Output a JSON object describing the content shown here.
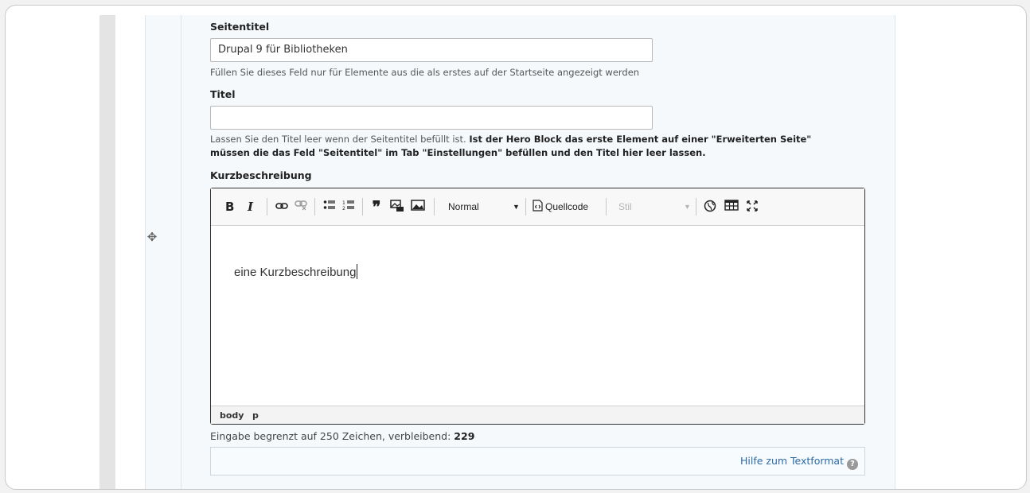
{
  "seitentitel": {
    "label": "Seitentitel",
    "value": "Drupal 9 für Bibliotheken",
    "help": "Füllen Sie dieses Feld nur für Elemente aus die als erstes auf der Startseite angezeigt werden"
  },
  "titel": {
    "label": "Titel",
    "value": "",
    "help_plain": "Lassen Sie den Titel leer wenn der Seitentitel befüllt ist.",
    "help_bold_1": "Ist der Hero Block das erste Element auf einer \"Erweiterten Seite\"",
    "help_bold_2": "müssen die das Feld \"Seitentitel\" im Tab \"Einstellungen\" befüllen und den Titel hier leer lassen."
  },
  "kurzbeschreibung": {
    "label": "Kurzbeschreibung",
    "content": "eine Kurzbeschreibung",
    "toolbar": {
      "bold": "B",
      "italic": "I",
      "format_select": "Normal",
      "source_button": "Quellcode",
      "style_select": "Stil"
    },
    "path": [
      "body",
      "p"
    ],
    "limit_text": "Eingabe begrenzt auf 250 Zeichen, verbleibend: ",
    "limit_remaining": "229"
  },
  "format_help": {
    "label": "Hilfe zum Textformat",
    "icon": "?"
  },
  "drag_handle": "✥"
}
